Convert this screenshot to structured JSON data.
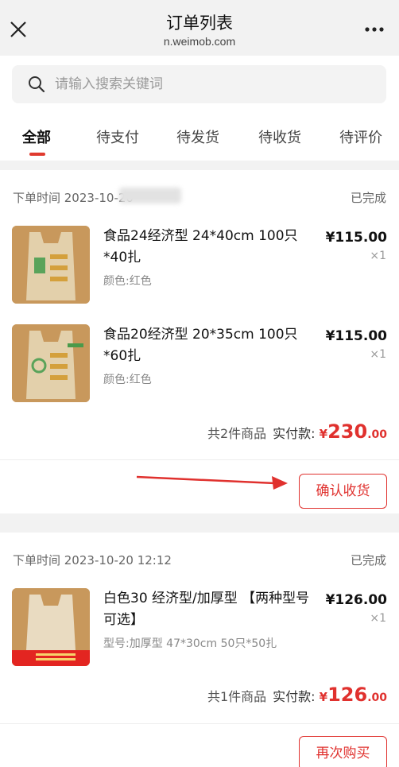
{
  "header": {
    "title": "订单列表",
    "subtitle": "n.weimob.com",
    "close_icon": "close-icon",
    "more_icon": "more-icon"
  },
  "search": {
    "placeholder": "请输入搜索关键词"
  },
  "tabs": [
    {
      "label": "全部",
      "active": true
    },
    {
      "label": "待支付"
    },
    {
      "label": "待发货"
    },
    {
      "label": "待收货"
    },
    {
      "label": "待评价"
    }
  ],
  "orders": [
    {
      "time_label": "下单时间 2023-10-20",
      "status": "已完成",
      "items": [
        {
          "name": "食品24经济型 24*40cm 100只*40扎",
          "spec": "颜色:红色",
          "price": "¥115.00",
          "qty": "×1"
        },
        {
          "name": "食品20经济型 20*35cm 100只*60扎",
          "spec": "颜色:红色",
          "price": "¥115.00",
          "qty": "×1"
        }
      ],
      "count_text": "共2件商品",
      "paid_label": "实付款:",
      "total_currency": "¥",
      "total_int": "230",
      "total_dec": ".00",
      "action": "确认收货"
    },
    {
      "time_label": "下单时间 2023-10-20 12:12",
      "status": "已完成",
      "items": [
        {
          "name": "白色30 经济型/加厚型 【两种型号可选】",
          "spec": "型号:加厚型 47*30cm 50只*50扎",
          "price": "¥126.00",
          "qty": "×1"
        }
      ],
      "count_text": "共1件商品",
      "paid_label": "实付款:",
      "total_currency": "¥",
      "total_int": "126",
      "total_dec": ".00",
      "action": "再次购买"
    }
  ],
  "colors": {
    "accent": "#e0312e",
    "background": "#f2f2f2"
  }
}
